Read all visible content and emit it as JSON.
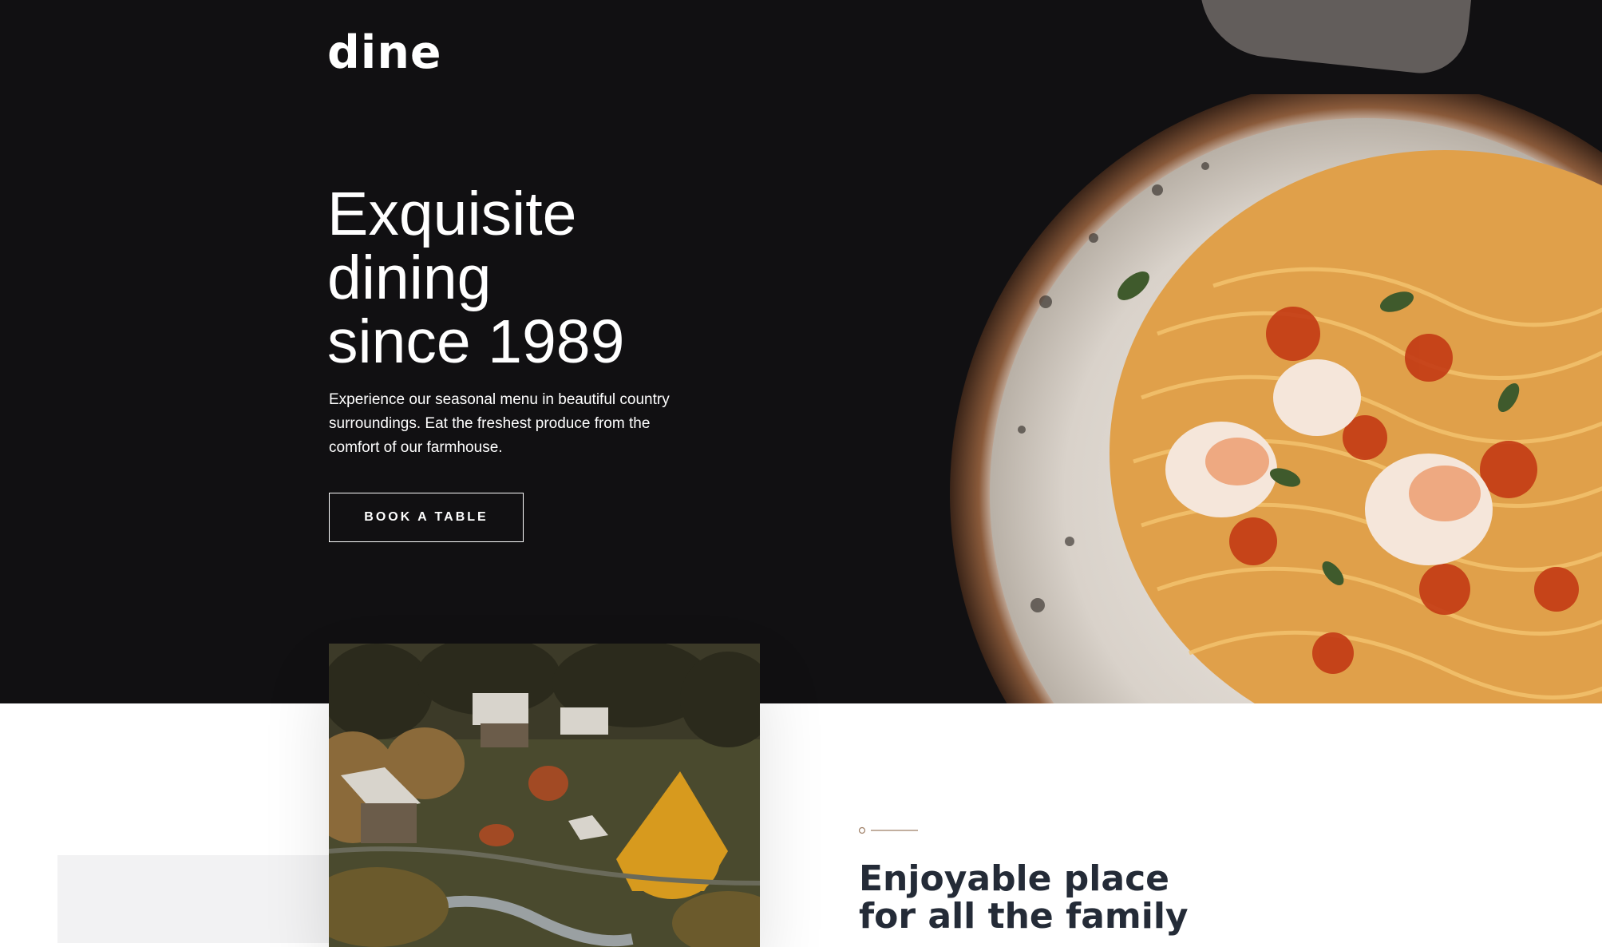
{
  "brand": {
    "logo_text": "dine"
  },
  "hero": {
    "title_lines": [
      "Exquisite",
      "dining",
      "since 1989"
    ],
    "description": "Experience our seasonal menu in beautiful country surroundings. Eat the freshest produce from the comfort of our farmhouse.",
    "cta_label": "BOOK A TABLE",
    "image": "pasta-plate-image"
  },
  "features": {
    "image": "village-image",
    "heading_lines": [
      "Enjoyable place",
      "for all the family"
    ],
    "accent_color": "#9e7f66"
  },
  "colors": {
    "hero_bg": "#111012",
    "text_dark": "#242b37",
    "page_bg": "#ffffff"
  }
}
